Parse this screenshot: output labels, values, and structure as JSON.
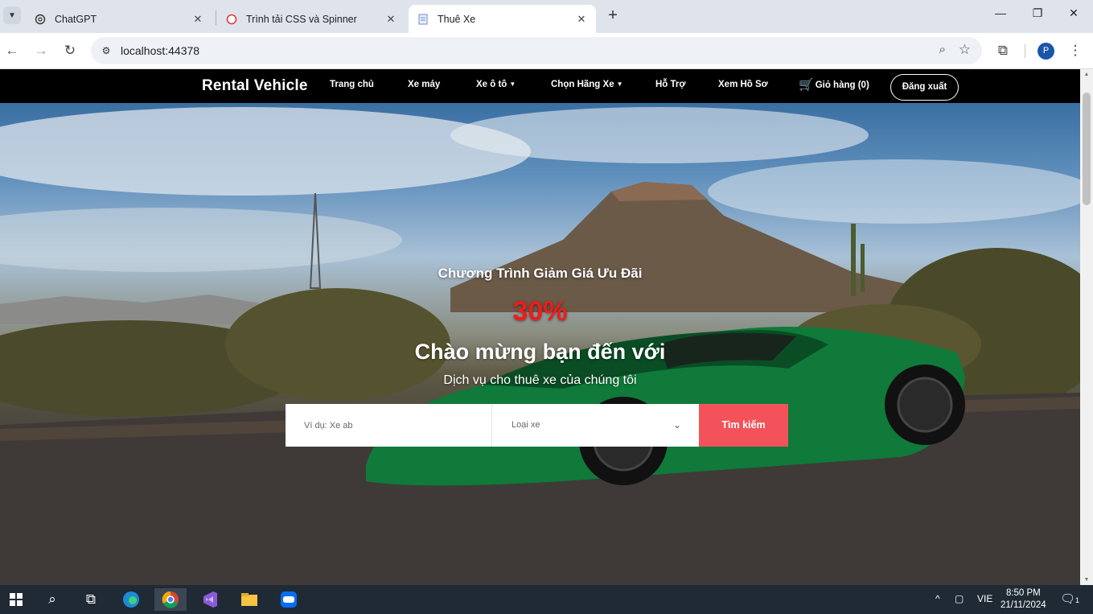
{
  "browser": {
    "tabs": [
      {
        "title": "ChatGPT",
        "icon": "chatgpt-icon",
        "active": false
      },
      {
        "title": "Trình tải CSS và Spinner",
        "icon": "spinner-icon",
        "active": false
      },
      {
        "title": "Thuê Xe",
        "icon": "page-icon",
        "active": true
      }
    ],
    "url": "localhost:44378",
    "profile_initial": "P"
  },
  "site": {
    "brand": "Rental Vehicle",
    "nav": {
      "home": "Trang chủ",
      "motorbike": "Xe máy",
      "car": "Xe ô tô",
      "brand": "Chọn Hãng Xe",
      "support": "Hỗ Trợ",
      "profile": "Xem Hồ Sơ",
      "cart": "Giỏ hàng (0)",
      "logout": "Đăng xuất"
    },
    "hero": {
      "promo_title": "Chương Trình Giảm Giá Ưu Đãi",
      "promo_percent": "30%",
      "welcome": "Chào mừng bạn đến với",
      "subtitle": "Dịch vụ cho thuê xe của chúng tôi"
    },
    "search": {
      "placeholder": "Ví dụ: Xe ab",
      "type_label": "Loại xe",
      "button": "Tìm kiếm"
    },
    "colors": {
      "accent": "#f4525a",
      "promo": "#ee1c1c",
      "navbar": "#000000"
    }
  },
  "taskbar": {
    "language": "VIE",
    "time": "8:50 PM",
    "date": "21/11/2024",
    "notification_count": "1",
    "apps": [
      "windows-start-icon",
      "search-icon",
      "task-view-icon",
      "edge-icon",
      "chrome-icon",
      "visual-studio-icon",
      "file-explorer-icon",
      "zalo-icon"
    ]
  }
}
